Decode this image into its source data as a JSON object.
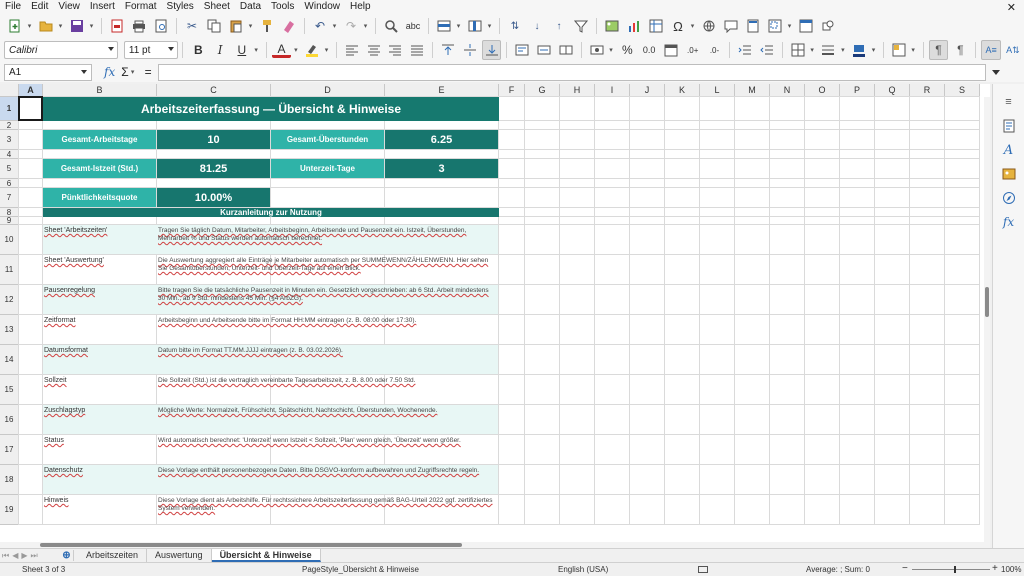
{
  "menu": [
    "File",
    "Edit",
    "View",
    "Insert",
    "Format",
    "Styles",
    "Sheet",
    "Data",
    "Tools",
    "Window",
    "Help"
  ],
  "close_glyph": "✕",
  "toolbar": {
    "font_name": "Calibri",
    "font_size": "11 pt",
    "percent": "%",
    "decimal_0": "0.0",
    "bold": "B",
    "italic": "I",
    "underline": "U",
    "font_color_letter": "A"
  },
  "formula_bar": {
    "cell_ref": "A1",
    "fx": "fx",
    "sigma": "Σ",
    "equals": "=",
    "content": ""
  },
  "columns": [
    "A",
    "B",
    "C",
    "D",
    "E",
    "F",
    "G",
    "H",
    "I",
    "J",
    "K",
    "L",
    "M",
    "N",
    "O",
    "P",
    "Q",
    "R",
    "S"
  ],
  "rows": [
    "1",
    "2",
    "3",
    "4",
    "5",
    "6",
    "7",
    "8",
    "9",
    "10",
    "11",
    "12",
    "13",
    "14",
    "15",
    "16",
    "17",
    "18",
    "19"
  ],
  "sheet": {
    "title": "Arbeitszeiterfassung — Übersicht & Hinweise",
    "kpis": [
      {
        "label": "Gesamt-Arbeitstage",
        "value": "10"
      },
      {
        "label": "Gesamt-Überstunden",
        "value": "6.25"
      },
      {
        "label": "Gesamt-Istzeit (Std.)",
        "value": "81.25"
      },
      {
        "label": "Unterzeit-Tage",
        "value": "3"
      },
      {
        "label": "Pünktlichkeitsquote",
        "value": "10.00%"
      }
    ],
    "section_header": "Kurzanleitung zur Nutzung",
    "guide": [
      {
        "topic": "Sheet 'Arbeitszeiten'",
        "text": "Tragen Sie täglich Datum, Mitarbeiter, Arbeitsbeginn, Arbeitsende und Pausenzeit ein. Istzeit, Überstunden, Mehrarbeit % und Status werden automatisch berechnet."
      },
      {
        "topic": "Sheet 'Auswertung'",
        "text": "Die Auswertung aggregiert alle Einträge je Mitarbeiter automatisch per SUMMEWENN/ZÄHLENWENN. Hier sehen Sie Gesamtüberstunden, Unterzeit- und Überzeit-Tage auf einen Blick."
      },
      {
        "topic": "Pausenregelung",
        "text": "Bitte tragen Sie die tatsächliche Pausenzeit in Minuten ein. Gesetzlich vorgeschrieben: ab 6 Std. Arbeit mindestens 30 Min., ab 9 Std. mindestens 45 Min. (§4 ArbZG)."
      },
      {
        "topic": "Zeitformat",
        "text": "Arbeitsbeginn und Arbeitsende bitte im Format HH:MM eintragen (z. B. 08:00 oder 17:30)."
      },
      {
        "topic": "Datumsformat",
        "text": "Datum bitte im Format TT.MM.JJJJ eintragen (z. B. 03.02.2026)."
      },
      {
        "topic": "Sollzeit",
        "text": "Die Sollzeit (Std.) ist die vertraglich vereinbarte Tagesarbeitszeit, z. B. 8.00 oder 7.50 Std."
      },
      {
        "topic": "Zuschlagstyp",
        "text": "Mögliche Werte: Normalzeit, Frühschicht, Spätschicht, Nachtschicht, Überstunden, Wochenende."
      },
      {
        "topic": "Status",
        "text": "Wird automatisch berechnet: 'Unterzeit' wenn Istzeit < Sollzeit, 'Plan' wenn gleich, 'Überzeit' wenn größer."
      },
      {
        "topic": "Datenschutz",
        "text": "Diese Vorlage enthält personenbezogene Daten. Bitte DSGVO-konform aufbewahren und Zugriffsrechte regeln."
      },
      {
        "topic": "Hinweis",
        "text": "Diese Vorlage dient als Arbeitshilfe. Für rechtssichere Arbeitszeiterfassung gemäß BAG-Urteil 2022 ggf. zertifiziertes System verwenden."
      }
    ]
  },
  "tabs": {
    "add": "⊕",
    "items": [
      "Arbeitszeiten",
      "Auswertung",
      "Übersicht & Hinweise"
    ],
    "active_index": 2
  },
  "status": {
    "sheet": "Sheet 3 of 3",
    "page_style": "PageStyle_Übersicht & Hinweise",
    "language": "English (USA)",
    "summary": "Average: ; Sum: 0",
    "zoom": "100%"
  }
}
